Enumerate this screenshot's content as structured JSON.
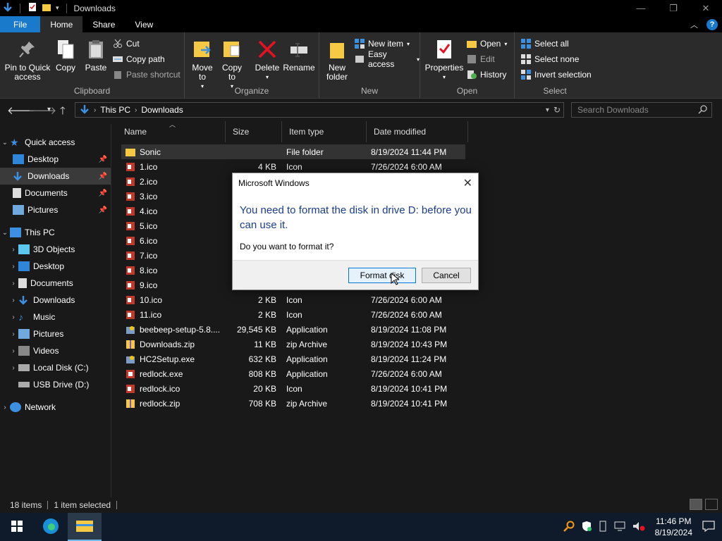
{
  "window": {
    "title": "Downloads"
  },
  "ribbon_tabs": [
    "File",
    "Home",
    "Share",
    "View"
  ],
  "ribbon": {
    "clipboard": {
      "name": "Clipboard",
      "pin_label": "Pin to Quick access",
      "copy_label": "Copy",
      "paste_label": "Paste",
      "cut_label": "Cut",
      "copy_path_label": "Copy path",
      "paste_shortcut_label": "Paste shortcut"
    },
    "organize": {
      "name": "Organize",
      "move_to_label": "Move to",
      "copy_to_label": "Copy to",
      "delete_label": "Delete",
      "rename_label": "Rename"
    },
    "new": {
      "name": "New",
      "new_folder_label": "New folder",
      "new_item_label": "New item",
      "easy_access_label": "Easy access"
    },
    "open": {
      "name": "Open",
      "properties_label": "Properties",
      "open_label": "Open",
      "edit_label": "Edit",
      "history_label": "History"
    },
    "select": {
      "name": "Select",
      "select_all_label": "Select all",
      "select_none_label": "Select none",
      "invert_label": "Invert selection"
    }
  },
  "address": {
    "crumbs": [
      "This PC",
      "Downloads"
    ],
    "search_placeholder": "Search Downloads"
  },
  "nav": {
    "quick_access": "Quick access",
    "quick_items": [
      "Desktop",
      "Downloads",
      "Documents",
      "Pictures"
    ],
    "this_pc": "This PC",
    "pc_items": [
      "3D Objects",
      "Desktop",
      "Documents",
      "Downloads",
      "Music",
      "Pictures",
      "Videos",
      "Local Disk (C:)",
      "USB Drive (D:)"
    ],
    "network": "Network"
  },
  "columns": {
    "name": "Name",
    "size": "Size",
    "type": "Item type",
    "date": "Date modified"
  },
  "files": [
    {
      "name": "Sonic",
      "size": "",
      "type": "File folder",
      "date": "8/19/2024 11:44 PM",
      "icon": "folder-icon"
    },
    {
      "name": "1.ico",
      "size": "4 KB",
      "type": "Icon",
      "date": "7/26/2024 6:00 AM",
      "icon": "ico-file-icon"
    },
    {
      "name": "2.ico",
      "size": "",
      "type": "",
      "date": "",
      "icon": "ico-file-icon"
    },
    {
      "name": "3.ico",
      "size": "",
      "type": "",
      "date": "",
      "icon": "ico-file-icon"
    },
    {
      "name": "4.ico",
      "size": "",
      "type": "",
      "date": "",
      "icon": "ico-file-icon"
    },
    {
      "name": "5.ico",
      "size": "",
      "type": "",
      "date": "",
      "icon": "ico-file-icon"
    },
    {
      "name": "6.ico",
      "size": "",
      "type": "",
      "date": "",
      "icon": "ico-file-icon"
    },
    {
      "name": "7.ico",
      "size": "",
      "type": "",
      "date": "",
      "icon": "ico-file-icon"
    },
    {
      "name": "8.ico",
      "size": "",
      "type": "",
      "date": "",
      "icon": "ico-file-icon"
    },
    {
      "name": "9.ico",
      "size": "",
      "type": "",
      "date": "",
      "icon": "ico-file-icon"
    },
    {
      "name": "10.ico",
      "size": "2 KB",
      "type": "Icon",
      "date": "7/26/2024 6:00 AM",
      "icon": "ico-file-icon"
    },
    {
      "name": "11.ico",
      "size": "2 KB",
      "type": "Icon",
      "date": "7/26/2024 6:00 AM",
      "icon": "ico-file-icon"
    },
    {
      "name": "beebeep-setup-5.8....",
      "size": "29,545 KB",
      "type": "Application",
      "date": "8/19/2024 11:08 PM",
      "icon": "setup-app-icon"
    },
    {
      "name": "Downloads.zip",
      "size": "11 KB",
      "type": "zip Archive",
      "date": "8/19/2024 10:43 PM",
      "icon": "zip-icon"
    },
    {
      "name": "HC2Setup.exe",
      "size": "632 KB",
      "type": "Application",
      "date": "8/19/2024 11:24 PM",
      "icon": "setup-app-icon"
    },
    {
      "name": "redlock.exe",
      "size": "808 KB",
      "type": "Application",
      "date": "7/26/2024 6:00 AM",
      "icon": "exe-icon"
    },
    {
      "name": "redlock.ico",
      "size": "20 KB",
      "type": "Icon",
      "date": "8/19/2024 10:41 PM",
      "icon": "ico-file-icon"
    },
    {
      "name": "redlock.zip",
      "size": "708 KB",
      "type": "zip Archive",
      "date": "8/19/2024 10:41 PM",
      "icon": "zip-icon"
    }
  ],
  "status": {
    "items": "18 items",
    "selected": "1 item selected"
  },
  "dialog": {
    "title": "Microsoft Windows",
    "heading": "You need to format the disk in drive D: before you can use it.",
    "body": "Do you want to format it?",
    "primary_label": "Format disk",
    "cancel_label": "Cancel"
  },
  "taskbar": {
    "time": "11:46 PM",
    "date": "8/19/2024"
  },
  "colors": {
    "accent": "#1979ca",
    "dialog_heading": "#1a3d8e",
    "folder": "#f6c945",
    "delete": "#e81123"
  }
}
